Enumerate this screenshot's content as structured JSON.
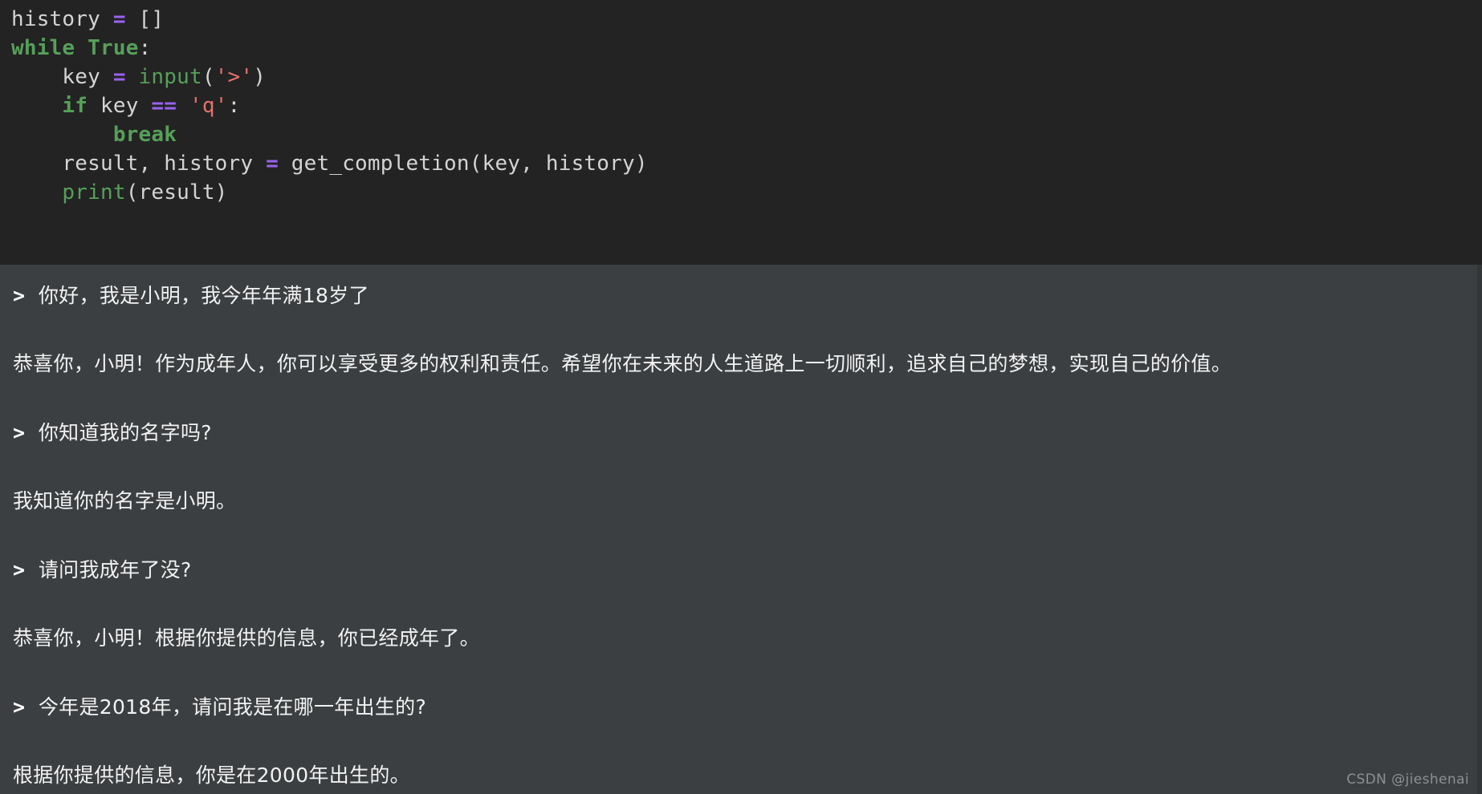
{
  "editor": {
    "language": "python",
    "background_color": "#232323",
    "default_text_color": "#d4d4d4",
    "keyword_color": "#56a05a",
    "operator_color": "#9a63f0",
    "string_color": "#e7706a",
    "lines": [
      {
        "id": "line-1",
        "tokens": [
          {
            "text": "history ",
            "type": "plain"
          },
          {
            "text": "=",
            "type": "operator"
          },
          {
            "text": " []",
            "type": "plain"
          }
        ]
      },
      {
        "id": "line-2",
        "tokens": [
          {
            "text": "while",
            "type": "keyword"
          },
          {
            "text": " ",
            "type": "plain"
          },
          {
            "text": "True",
            "type": "keyword"
          },
          {
            "text": ":",
            "type": "plain"
          }
        ]
      },
      {
        "id": "line-3",
        "tokens": [
          {
            "text": "    key ",
            "type": "plain"
          },
          {
            "text": "=",
            "type": "operator"
          },
          {
            "text": " ",
            "type": "plain"
          },
          {
            "text": "input",
            "type": "function"
          },
          {
            "text": "(",
            "type": "plain"
          },
          {
            "text": "'>'",
            "type": "string"
          },
          {
            "text": ")",
            "type": "plain"
          }
        ]
      },
      {
        "id": "line-4",
        "tokens": [
          {
            "text": "    ",
            "type": "plain"
          },
          {
            "text": "if",
            "type": "keyword"
          },
          {
            "text": " key ",
            "type": "plain"
          },
          {
            "text": "==",
            "type": "operator"
          },
          {
            "text": " ",
            "type": "plain"
          },
          {
            "text": "'q'",
            "type": "string"
          },
          {
            "text": ":",
            "type": "plain"
          }
        ]
      },
      {
        "id": "line-5",
        "tokens": [
          {
            "text": "        ",
            "type": "plain"
          },
          {
            "text": "break",
            "type": "keyword"
          }
        ]
      },
      {
        "id": "line-6",
        "tokens": [
          {
            "text": "    result, history ",
            "type": "plain"
          },
          {
            "text": "=",
            "type": "operator"
          },
          {
            "text": " get_completion(key, history)",
            "type": "plain"
          }
        ]
      },
      {
        "id": "line-7",
        "tokens": [
          {
            "text": "    ",
            "type": "plain"
          },
          {
            "text": "print",
            "type": "function"
          },
          {
            "text": "(result)",
            "type": "plain"
          }
        ]
      }
    ]
  },
  "console": {
    "background_color": "#3c3f41",
    "text_color": "#f2f2f2",
    "prompt_symbol": ">",
    "entries": [
      {
        "id": "entry-1-user",
        "role": "user",
        "prompt": ">",
        "text": "你好，我是小明，我今年年满18岁了"
      },
      {
        "id": "entry-1-assistant",
        "role": "assistant",
        "prompt": "",
        "text": "恭喜你，小明！作为成年人，你可以享受更多的权利和责任。希望你在未来的人生道路上一切顺利，追求自己的梦想，实现自己的价值。"
      },
      {
        "id": "entry-2-user",
        "role": "user",
        "prompt": ">",
        "text": "你知道我的名字吗?"
      },
      {
        "id": "entry-2-assistant",
        "role": "assistant",
        "prompt": "",
        "text": "我知道你的名字是小明。"
      },
      {
        "id": "entry-3-user",
        "role": "user",
        "prompt": ">",
        "text": "请问我成年了没?"
      },
      {
        "id": "entry-3-assistant",
        "role": "assistant",
        "prompt": "",
        "text": "恭喜你，小明！根据你提供的信息，你已经成年了。"
      },
      {
        "id": "entry-4-user",
        "role": "user",
        "prompt": ">",
        "text": "今年是2018年，请问我是在哪一年出生的?"
      },
      {
        "id": "entry-4-assistant",
        "role": "assistant",
        "prompt": "",
        "text": "根据你提供的信息，你是在2000年出生的。"
      }
    ]
  },
  "watermark": {
    "text": "CSDN @jieshenai"
  }
}
